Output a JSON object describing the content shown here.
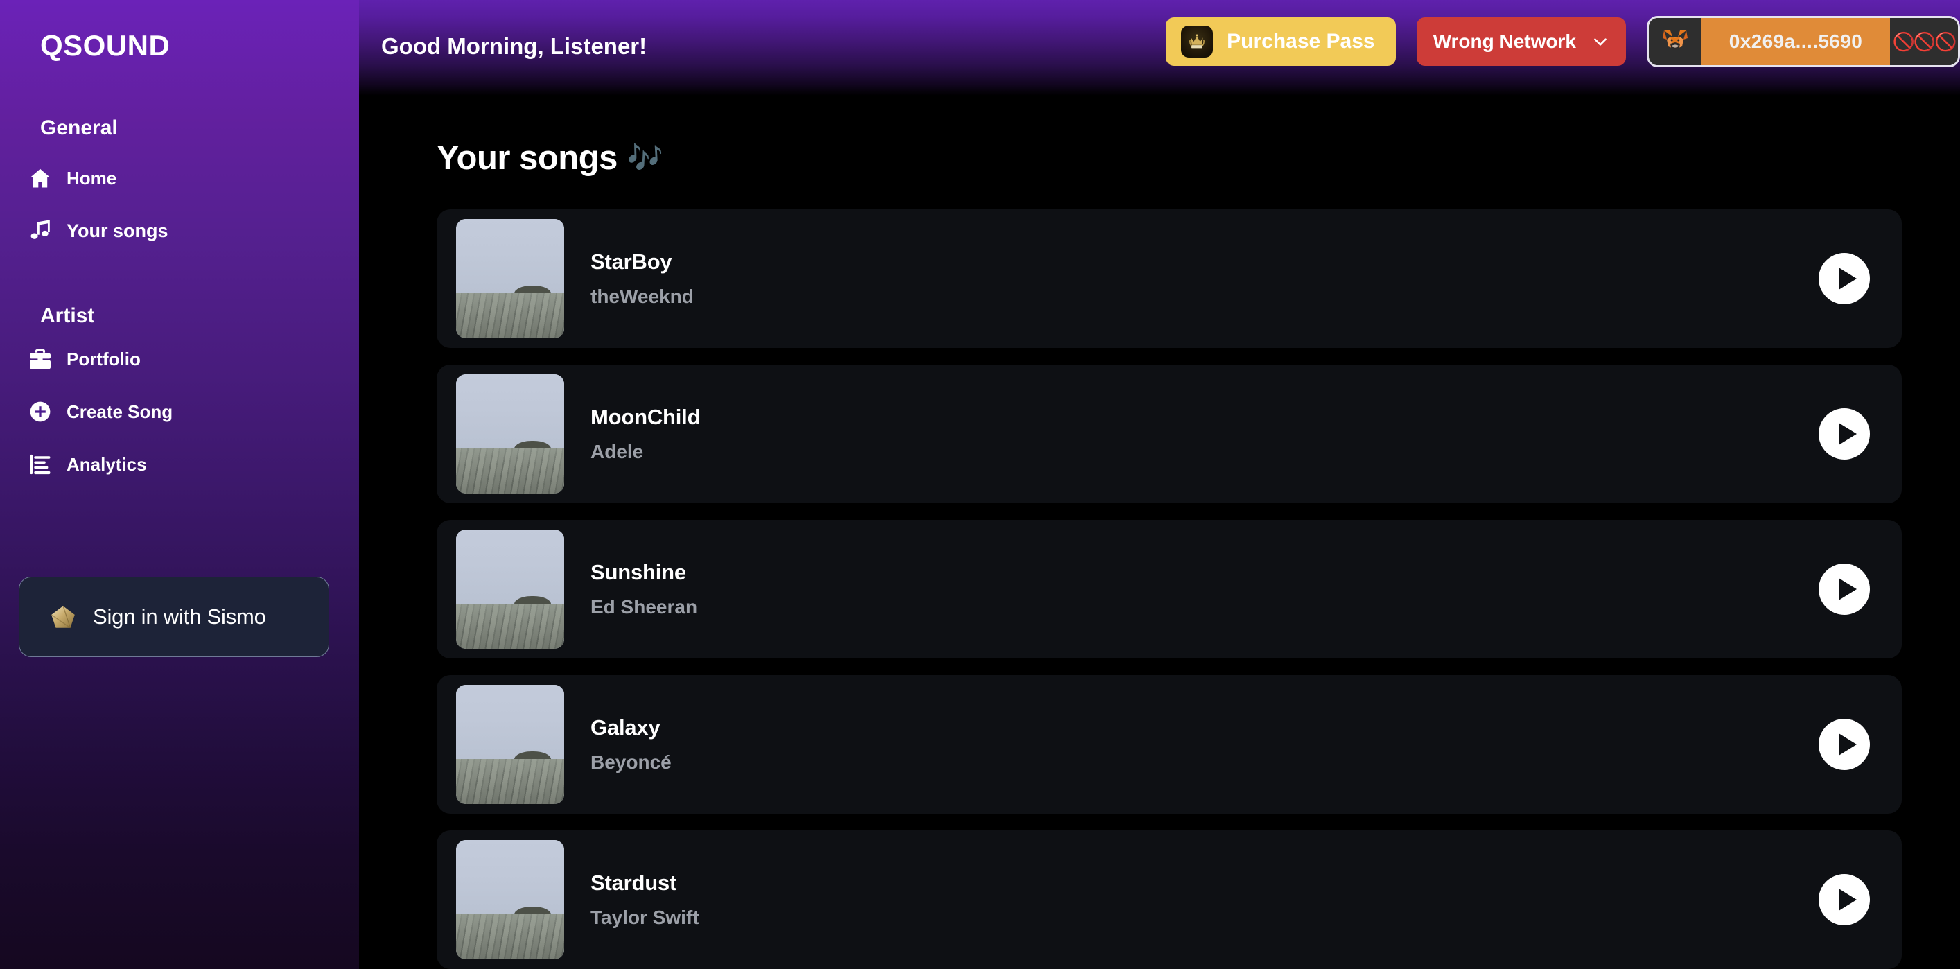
{
  "sidebar": {
    "brand": "QSOUND",
    "sections": [
      {
        "title": "General",
        "items": [
          {
            "label": "Home",
            "icon": "home-icon"
          },
          {
            "label": "Your songs",
            "icon": "music-note-icon"
          }
        ]
      },
      {
        "title": "Artist",
        "items": [
          {
            "label": "Portfolio",
            "icon": "briefcase-icon"
          },
          {
            "label": "Create Song",
            "icon": "plus-circle-icon"
          },
          {
            "label": "Analytics",
            "icon": "bar-chart-icon"
          }
        ]
      }
    ],
    "sismo_button": {
      "label": "Sign in with Sismo",
      "icon": "sismo-pentagon-icon"
    }
  },
  "header": {
    "greeting": "Good Morning, Listener!",
    "purchase_pass": {
      "label": "Purchase Pass",
      "icon": "crown-badge-icon",
      "bg_color": "#f2ca57"
    },
    "network": {
      "label": "Wrong Network",
      "chevron": "chevron-down-icon",
      "bg_color": "#cd3c38"
    },
    "wallet": {
      "address": "0x269a....5690",
      "wallet_icon": "metamask-fox-icon",
      "status_icons": "🚫🚫🚫",
      "address_bg": "#e08b38"
    }
  },
  "main": {
    "title": "Your songs",
    "title_emoji": "🎶",
    "songs": [
      {
        "title": "StarBoy",
        "artist": "theWeeknd",
        "play": "play-icon"
      },
      {
        "title": "MoonChild",
        "artist": "Adele",
        "play": "play-icon"
      },
      {
        "title": "Sunshine",
        "artist": "Ed Sheeran",
        "play": "play-icon"
      },
      {
        "title": "Galaxy",
        "artist": "Beyoncé",
        "play": "play-icon"
      },
      {
        "title": "Stardust",
        "artist": "Taylor Swift",
        "play": "play-icon"
      }
    ]
  },
  "colors": {
    "sidebar_top": "#6b22b8",
    "sidebar_bottom": "#150820",
    "card_bg": "#0e1014",
    "page_bg": "#000000",
    "accent_yellow": "#f2ca57",
    "accent_red": "#cd3c38",
    "accent_orange": "#e08b38"
  }
}
